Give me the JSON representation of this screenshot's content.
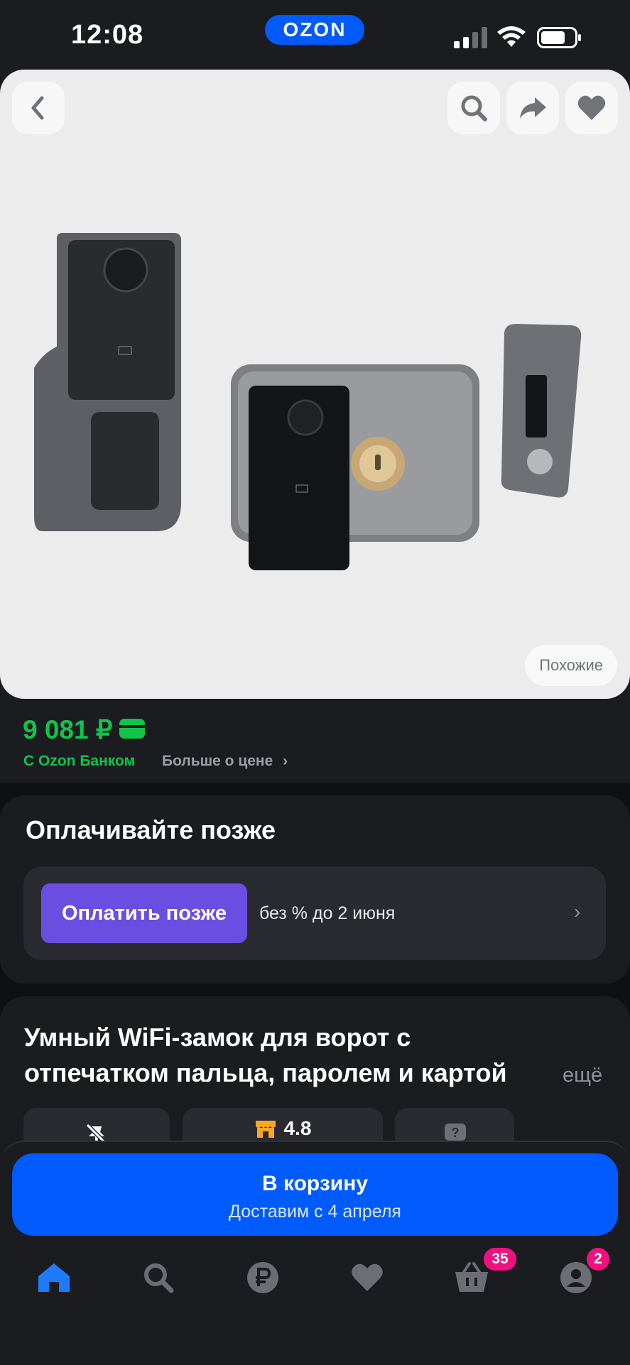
{
  "status_bar": {
    "time": "12:08",
    "brand": "OZON"
  },
  "gallery": {
    "similar_label": "Похожие"
  },
  "price": {
    "value": "9 081 ₽",
    "bank_label": "С Ozon Банком",
    "more_label": "Больше о цене"
  },
  "pay_later": {
    "title": "Оплачивайте позже",
    "button_label": "Оплатить позже",
    "note": "без % до 2 июня"
  },
  "product": {
    "title_line1": "Умный WiFi-замок для ворот с",
    "title_line2": "отпечатком пальца, паролем и картой",
    "more_label": "ещё",
    "rating": "4.8"
  },
  "cart": {
    "label": "В корзину",
    "delivery": "Доставим с 4 апреля"
  },
  "nav": {
    "cart_badge": "35",
    "profile_badge": "2",
    "items": [
      "home-icon",
      "search-icon",
      "ruble-icon",
      "heart-icon",
      "basket-icon",
      "profile-icon"
    ]
  },
  "colors": {
    "accent": "#005bff",
    "price_green": "#10c44c",
    "pay_purple": "#6a4ee1",
    "badge_pink": "#f1117e"
  }
}
